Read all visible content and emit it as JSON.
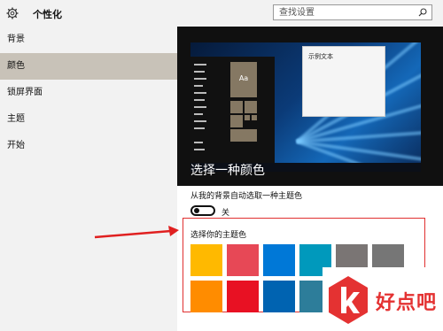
{
  "header": {
    "title": "个性化",
    "search_placeholder": "查找设置"
  },
  "sidebar": {
    "items": [
      {
        "label": "背景",
        "active": false
      },
      {
        "label": "颜色",
        "active": true
      },
      {
        "label": "锁屏界面",
        "active": false
      },
      {
        "label": "主题",
        "active": false
      },
      {
        "label": "开始",
        "active": false
      }
    ]
  },
  "preview": {
    "title": "选择一种颜色",
    "sample_text": "示例文本",
    "tile_text": "Aa"
  },
  "auto_color": {
    "label": "从我的背景自动选取一种主题色",
    "state": "关"
  },
  "colors": {
    "label": "选择你的主题色",
    "swatches": [
      "#FFB900",
      "#E74856",
      "#0078D7",
      "#0099BC",
      "#7A7574",
      "#767676",
      "#FF8C00",
      "#E81123",
      "#0063B1",
      "#2D7D9A",
      "#5D5A58",
      "#4C4A48"
    ]
  },
  "watermark": {
    "text": "好点吧"
  }
}
